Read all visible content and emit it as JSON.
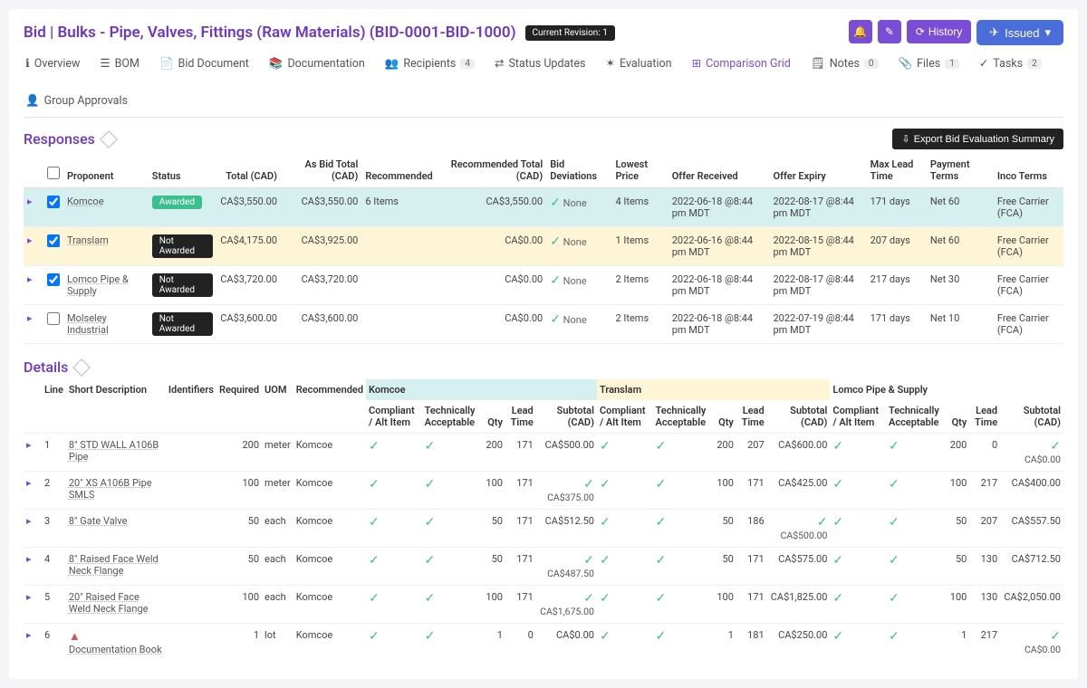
{
  "header": {
    "title": "Bid | Bulks - Pipe, Valves, Fittings (Raw Materials) (BID-0001-BID-1000)",
    "revision_chip": "Current Revision: 1",
    "history_label": "History",
    "issued_label": "Issued"
  },
  "tabs": [
    {
      "label": "Overview"
    },
    {
      "label": "BOM"
    },
    {
      "label": "Bid Document"
    },
    {
      "label": "Documentation"
    },
    {
      "label": "Recipients",
      "badge": "4"
    },
    {
      "label": "Status Updates"
    },
    {
      "label": "Evaluation"
    },
    {
      "label": "Comparison Grid",
      "active": true
    },
    {
      "label": "Notes",
      "badge": "0"
    },
    {
      "label": "Files",
      "badge": "1"
    },
    {
      "label": "Tasks",
      "badge": "2"
    },
    {
      "label": "Group Approvals"
    }
  ],
  "responses": {
    "title": "Responses",
    "export_label": "Export Bid Evaluation Summary",
    "cols": {
      "proponent": "Proponent",
      "status": "Status",
      "total": "Total (CAD)",
      "asbid": "As Bid Total (CAD)",
      "recommended": "Recommended",
      "rectotal": "Recommended Total (CAD)",
      "biddev": "Bid Deviations",
      "lowest": "Lowest Price",
      "received": "Offer Received",
      "expiry": "Offer Expiry",
      "lead": "Max Lead Time",
      "payment": "Payment Terms",
      "inco": "Inco Terms"
    },
    "rows": [
      {
        "checked": true,
        "rowcls": "row-blue",
        "proponent": "Komcoe",
        "status": "Awarded",
        "statuscls": "awarded",
        "total": "CA$3,550.00",
        "asbid": "CA$3,550.00",
        "recommended": "6 Items",
        "rectotal": "CA$3,550.00",
        "biddev": "None",
        "lowest": "4 Items",
        "received": "2022-06-18 @8:44 pm MDT",
        "expiry": "2022-08-17 @8:44 pm MDT",
        "lead": "171 days",
        "payment": "Net 60",
        "inco": "Free Carrier (FCA)"
      },
      {
        "checked": true,
        "rowcls": "row-yellow",
        "proponent": "Translam",
        "status": "Not Awarded",
        "statuscls": "notawarded",
        "total": "CA$4,175.00",
        "asbid": "CA$3,925.00",
        "recommended": "",
        "rectotal": "CA$0.00",
        "biddev": "None",
        "lowest": "1 Items",
        "received": "2022-06-16 @8:44 pm MDT",
        "expiry": "2022-08-15 @8:44 pm MDT",
        "lead": "207 days",
        "payment": "Net 60",
        "inco": "Free Carrier (FCA)"
      },
      {
        "checked": true,
        "rowcls": "",
        "proponent": "Lomco Pipe & Supply",
        "status": "Not Awarded",
        "statuscls": "notawarded",
        "total": "CA$3,720.00",
        "asbid": "CA$3,720.00",
        "recommended": "",
        "rectotal": "CA$0.00",
        "biddev": "None",
        "lowest": "2 Items",
        "received": "2022-06-18 @8:44 pm MDT",
        "expiry": "2022-08-17 @8:44 pm MDT",
        "lead": "217 days",
        "payment": "Net 30",
        "inco": "Free Carrier (FCA)"
      },
      {
        "checked": false,
        "rowcls": "",
        "proponent": "Molseley Industrial",
        "status": "Not Awarded",
        "statuscls": "notawarded",
        "total": "CA$3,600.00",
        "asbid": "CA$3,600.00",
        "recommended": "",
        "rectotal": "CA$0.00",
        "biddev": "None",
        "lowest": "2 Items",
        "received": "2022-06-18 @8:44 pm MDT",
        "expiry": "2022-07-19 @8:44 pm MDT",
        "lead": "171 days",
        "payment": "Net 10",
        "inco": "Free Carrier (FCA)"
      }
    ]
  },
  "details": {
    "title": "Details",
    "cols": {
      "line": "Line",
      "short": "Short Description",
      "ident": "Identifiers",
      "req": "Required",
      "uom": "UOM",
      "rec": "Recommended",
      "compliant": "Compliant / Alt Item",
      "tech": "Technically Acceptable",
      "qty": "Qty",
      "lead": "Lead Time",
      "subtotal": "Subtotal (CAD)"
    },
    "vendors": [
      {
        "name": "Komcoe",
        "cls": "vh-blue"
      },
      {
        "name": "Translam",
        "cls": "vh-yellow"
      },
      {
        "name": "Lomco Pipe & Supply",
        "cls": ""
      }
    ],
    "rows": [
      {
        "line": "1",
        "desc": "8\" STD WALL A106B Pipe",
        "req": "200",
        "uom": "meter",
        "rec": "Komcoe",
        "v": [
          {
            "qty": "200",
            "lead": "171",
            "sub": "CA$500.00",
            "sub2": ""
          },
          {
            "qty": "200",
            "lead": "207",
            "sub": "CA$600.00",
            "sub2": ""
          },
          {
            "qty": "200",
            "lead": "0",
            "sub": "",
            "sub2": "CA$0.00"
          }
        ]
      },
      {
        "line": "2",
        "desc": "20\" XS A106B Pipe SMLS",
        "req": "100",
        "uom": "meter",
        "rec": "Komcoe",
        "v": [
          {
            "qty": "100",
            "lead": "171",
            "sub": "",
            "sub2": "CA$375.00"
          },
          {
            "qty": "100",
            "lead": "171",
            "sub": "CA$425.00",
            "sub2": ""
          },
          {
            "qty": "100",
            "lead": "217",
            "sub": "CA$400.00",
            "sub2": ""
          }
        ]
      },
      {
        "line": "3",
        "desc": "8\" Gate Valve",
        "req": "50",
        "uom": "each",
        "rec": "Komcoe",
        "v": [
          {
            "qty": "50",
            "lead": "171",
            "sub": "CA$512.50",
            "sub2": ""
          },
          {
            "qty": "50",
            "lead": "186",
            "sub": "",
            "sub2": "CA$500.00"
          },
          {
            "qty": "50",
            "lead": "207",
            "sub": "CA$557.50",
            "sub2": ""
          }
        ]
      },
      {
        "line": "4",
        "desc": "8\" Raised Face Weld Neck Flange",
        "req": "50",
        "uom": "each",
        "rec": "Komcoe",
        "v": [
          {
            "qty": "50",
            "lead": "171",
            "sub": "",
            "sub2": "CA$487.50"
          },
          {
            "qty": "50",
            "lead": "171",
            "sub": "CA$575.00",
            "sub2": ""
          },
          {
            "qty": "50",
            "lead": "130",
            "sub": "CA$712.50",
            "sub2": ""
          }
        ]
      },
      {
        "line": "5",
        "desc": "20\" Raised Face Weld Neck Flange",
        "req": "100",
        "uom": "each",
        "rec": "Komcoe",
        "v": [
          {
            "qty": "100",
            "lead": "171",
            "sub": "",
            "sub2": "CA$1,675.00"
          },
          {
            "qty": "100",
            "lead": "171",
            "sub": "CA$1,825.00",
            "sub2": ""
          },
          {
            "qty": "100",
            "lead": "130",
            "sub": "CA$2,050.00",
            "sub2": ""
          }
        ]
      },
      {
        "line": "6",
        "desc": "Documentation Book",
        "warn": true,
        "req": "1",
        "uom": "lot",
        "rec": "Komcoe",
        "v": [
          {
            "qty": "1",
            "lead": "0",
            "sub": "CA$0.00",
            "sub2": ""
          },
          {
            "qty": "1",
            "lead": "181",
            "sub": "CA$250.00",
            "sub2": ""
          },
          {
            "qty": "1",
            "lead": "217",
            "sub": "",
            "sub2": "CA$0.00"
          }
        ]
      }
    ]
  }
}
